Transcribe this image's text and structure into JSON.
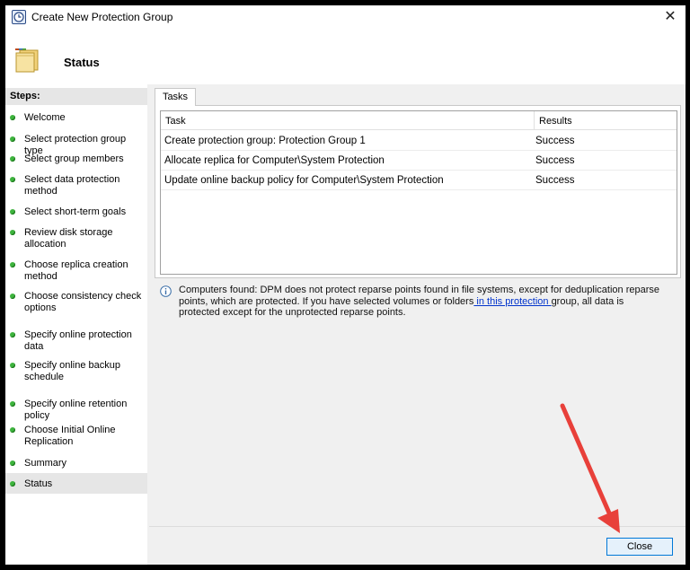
{
  "window": {
    "title": "Create New Protection Group",
    "close_glyph": "✕"
  },
  "header": {
    "title": "Status",
    "icon": "folder-stack-icon"
  },
  "steps": {
    "title": "Steps:",
    "items": [
      {
        "label": "Welcome"
      },
      {
        "label": "Select protection group type"
      },
      {
        "label": "Select group members"
      },
      {
        "label": "Select data protection method"
      },
      {
        "label": "Select short-term goals"
      },
      {
        "label": "Review disk storage allocation"
      },
      {
        "label": "Choose replica creation method"
      },
      {
        "label": "Choose consistency check options"
      },
      {
        "label": "Specify online protection data"
      },
      {
        "label": "Specify online backup schedule"
      },
      {
        "label": "Specify online retention policy"
      },
      {
        "label": "Choose Initial Online Replication"
      },
      {
        "label": "Summary"
      },
      {
        "label": "Status"
      }
    ],
    "active": "Status"
  },
  "tasks": {
    "tab_label": "Tasks",
    "columns": [
      "Task",
      "Results"
    ],
    "rows": [
      {
        "task": "Create protection group: Protection Group 1",
        "result": "Success"
      },
      {
        "task": "Allocate replica for Computer\\System Protection",
        "result": "Success"
      },
      {
        "task": "Update online backup policy for Computer\\System Protection",
        "result": "Success"
      }
    ]
  },
  "info": {
    "text_before": "Computers found: DPM does not protect reparse points found in file systems, except for deduplication reparse points, which are protected. If you have selected volumes or folders",
    "link_text": " in this protection ",
    "text_after": "group, all data is protected except for the unprotected reparse points."
  },
  "footer": {
    "close_label": "Close"
  },
  "colors": {
    "step_dot": "#3eb43e",
    "link": "#0033cc",
    "button_border": "#0078d7",
    "annotation_arrow": "#e8403a"
  }
}
